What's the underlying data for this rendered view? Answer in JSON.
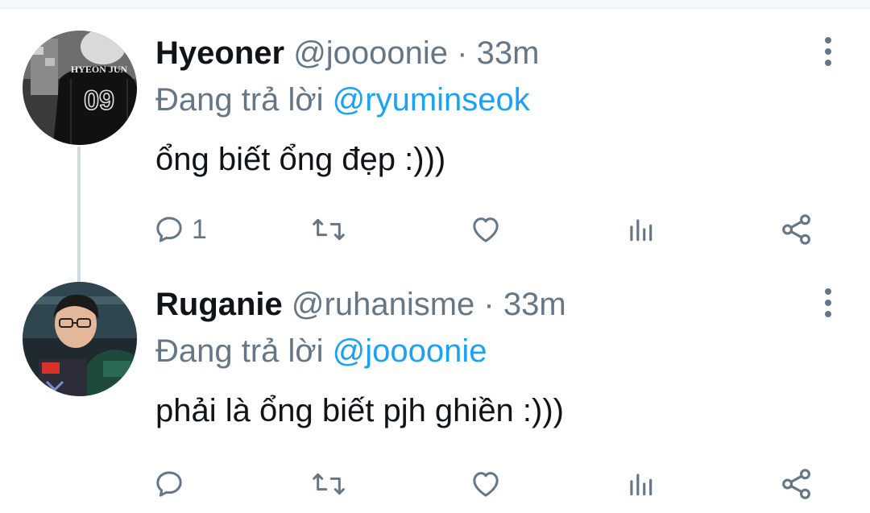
{
  "tweets": [
    {
      "display_name": "Hyeoner",
      "handle": "@joooonie",
      "separator": "·",
      "time": "33m",
      "reply_prefix": "Đang trả lời",
      "reply_to": "@ryuminseok",
      "text": "ổng biết ổng đẹp :)))",
      "reply_count": "1",
      "avatar_text": "HYEON JUN",
      "avatar_number": "09"
    },
    {
      "display_name": "Ruganie",
      "handle": "@ruhanisme",
      "separator": "·",
      "time": "33m",
      "reply_prefix": "Đang trả lời",
      "reply_to": "@joooonie",
      "text": "phải là ổng biết pjh ghiền :)))",
      "reply_count": ""
    }
  ],
  "icons": {
    "reply": "reply-icon",
    "retweet": "retweet-icon",
    "like": "heart-icon",
    "stats": "analytics-icon",
    "share": "share-icon",
    "more": "more-vertical-icon"
  },
  "colors": {
    "text": "#0f1419",
    "secondary": "#657786",
    "mention": "#1da1f2",
    "thread_line": "#cfd9de"
  }
}
